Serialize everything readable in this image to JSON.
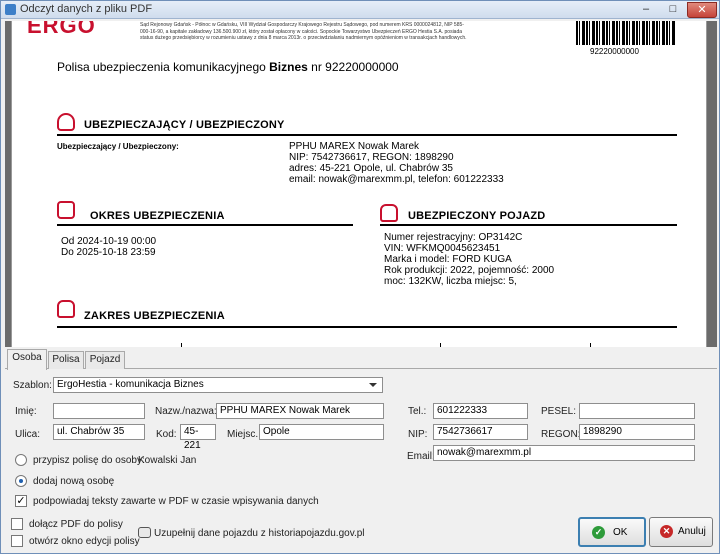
{
  "window": {
    "title": "Odczyt danych z pliku PDF",
    "min": "–",
    "max": "□",
    "close": "✕"
  },
  "pdf": {
    "logo": "ERGO",
    "legal": "Sąd Rejonowy Gdańsk - Północ w Gdańsku, VIII Wydział Gospodarczy Krajowego Rejestru Sądowego, pod numerem KRS 0000024812, NIP 585-000-16-90, a kapitale zakładowy 136.500.900 zł, który został opłacony w całości. Sopockie Towarzystwo Ubezpieczeń ERGO Hestia S.A. posiada status dużego przedsiębiorcy w rozumieniu ustawy z dnia 8 marca 2013r. o przeciwdziałaniu nadmiernym opóźnieniom w transakcjach handlowych.",
    "barcode_number": "92220000000",
    "policy_title_prefix": "Polisa ubezpieczenia komunikacyjnego",
    "policy_title_bold": "Biznes",
    "policy_title_suffix": "nr 92220000000",
    "insured": {
      "heading": "UBEZPIECZAJĄCY / UBEZPIECZONY",
      "label": "Ubezpieczający / Ubezpieczony:",
      "lines": [
        "PPHU MAREX Nowak Marek",
        "NIP: 7542736617, REGON: 1898290",
        "adres: 45-221 Opole, ul. Chabrów 35",
        "email: nowak@marexmm.pl, telefon: 601222333"
      ]
    },
    "period": {
      "heading": "OKRES UBEZPIECZENIA",
      "lines": [
        "Od 2024-10-19 00:00",
        "Do 2025-10-18 23:59"
      ]
    },
    "vehicle": {
      "heading": "UBEZPIECZONY POJAZD",
      "lines": [
        "Numer rejestracyjny: OP3142C",
        "VIN: WFKMQ0045623451",
        "Marka i model: FORD KUGA",
        "Rok produkcji: 2022, pojemność: 2000",
        "moc: 132KW, liczba miejsc: 5,"
      ]
    },
    "scope": {
      "heading": "ZAKRES UBEZPIECZENIA"
    }
  },
  "tabs": [
    "Osoba",
    "Polisa",
    "Pojazd"
  ],
  "form": {
    "template_label": "Szablon:",
    "template_value": "ErgoHestia - komunikacja Biznes",
    "first_name_label": "Imię:",
    "first_name": "",
    "surname_label": "Nazw./nazwa:",
    "surname": "PPHU MAREX Nowak Marek",
    "phone_label": "Tel.:",
    "phone": "601222333",
    "pesel_label": "PESEL:",
    "pesel": "",
    "street_label": "Ulica:",
    "street": "ul. Chabrów 35",
    "postal_label": "Kod:",
    "postal": "45-221",
    "city_label": "Miejsc.:",
    "city": "Opole",
    "nip_label": "NIP:",
    "nip": "7542736617",
    "regon_label": "REGON:",
    "regon": "1898290",
    "email_label": "Email:",
    "email": "nowak@marexmm.pl",
    "assign_label": "przypisz polisę do osoby:",
    "assign_person": "Kowalski Jan",
    "new_person_label": "dodaj nową osobę",
    "suggest_label": "podpowiadaj teksty zawarte w PDF w czasie wpisywania danych"
  },
  "footer": {
    "attach_pdf": "dołącz PDF do polisy",
    "open_editor": "otwórz okno edycji polisy",
    "fill_vehicle": "Uzupełnij dane pojazdu z historiapojazdu.gov.pl",
    "ok": "OK",
    "cancel": "Anuluj"
  },
  "colors": {
    "brand": "#c8102e",
    "ok_icon": "#2e9b3a",
    "cancel_icon": "#c62828"
  }
}
